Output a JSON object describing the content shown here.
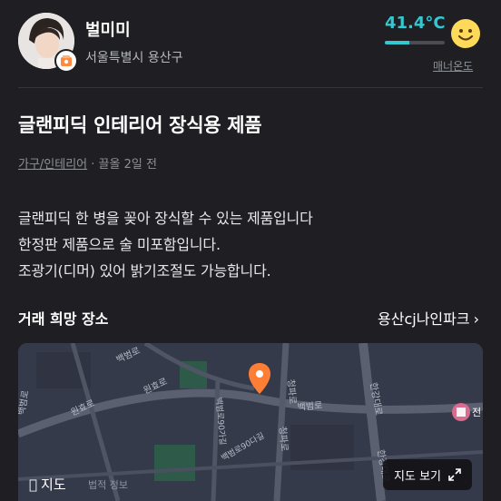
{
  "profile": {
    "nickname": "벌미미",
    "region": "서울특별시 용산구",
    "temperature": "41.4°C",
    "temperature_percent": 41.4,
    "manner_label": "매너온도",
    "temperature_color": "#33c8d2",
    "smile_icon": "smiley-face-icon"
  },
  "article": {
    "title": "글랜피딕 인테리어 장식용 제품",
    "category": "가구/인테리어",
    "meta_separator": " · ",
    "time": "끌올 2일 전",
    "body_lines": [
      "글랜피딕 한 병을 꽂아 장식할 수 있는 제품입니다",
      "한정판 제품으로 술 미포함입니다.",
      "조광기(디머) 있어 밝기조절도 가능합니다."
    ]
  },
  "place": {
    "label": "거래 희망 장소",
    "name": "용산cj나인파크",
    "chevron": "›"
  },
  "map": {
    "logo_text": "지도",
    "legal_text": "법적 정보",
    "view_button": "지도 보기",
    "pin_color": "#ff7e36",
    "poi_label": "전",
    "street_labels": [
      "백범로",
      "원효로",
      "원효로",
      "백범로",
      "청파로",
      "백범로90가길",
      "백범로90다길",
      "한강대로",
      "한강대로",
      "청파로",
      "백범로"
    ]
  }
}
